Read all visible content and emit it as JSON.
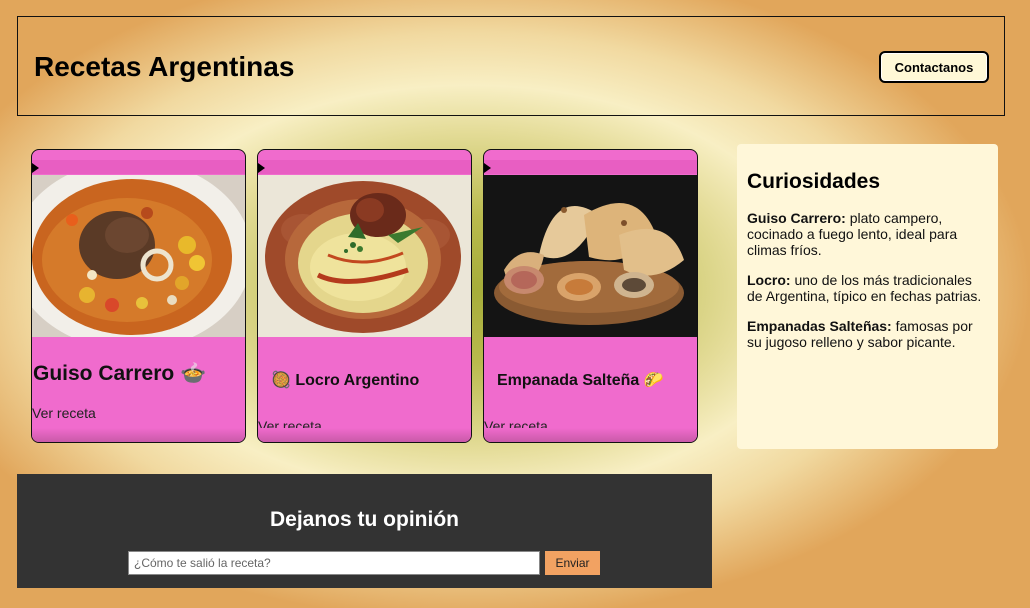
{
  "header": {
    "title": "Recetas Argentinas",
    "contact_label": "Contactanos"
  },
  "cards": [
    {
      "title": "Guiso Carrero 🍲",
      "link": "Ver receta"
    },
    {
      "title": "🥘 Locro Argentino",
      "link": "Ver receta"
    },
    {
      "title": "Empanada Salteña 🌮",
      "link": "Ver receta"
    }
  ],
  "aside": {
    "heading": "Curiosidades",
    "items": [
      {
        "term": "Guiso Carrero:",
        "text": " plato campero, cocinado a fuego lento, ideal para climas fríos."
      },
      {
        "term": "Locro:",
        "text": " uno de los más tradicionales de Argentina, típico en fechas patrias."
      },
      {
        "term": "Empanadas Salteñas:",
        "text": " famosas por su jugoso relleno y sabor picante."
      }
    ]
  },
  "feedback": {
    "heading": "Dejanos tu opinión",
    "placeholder": "¿Cómo te salió la receta?",
    "submit_label": "Enviar"
  },
  "colors": {
    "card": "#f06bcd",
    "button": "#f2a262",
    "panel": "#fff7d9",
    "footer": "#333333"
  }
}
